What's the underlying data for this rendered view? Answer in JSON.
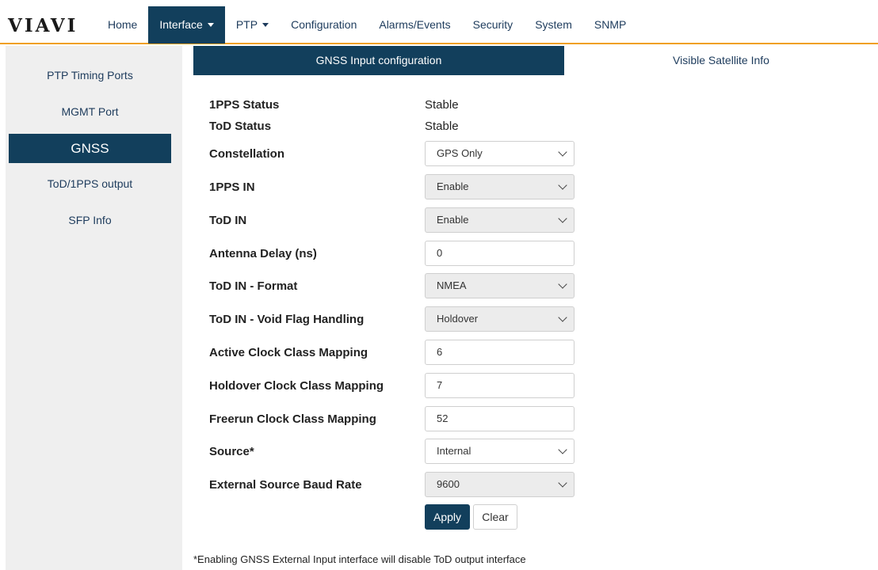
{
  "brand": {
    "logo_text": "VIAVI"
  },
  "nav": {
    "items": [
      {
        "label": "Home",
        "dropdown": false,
        "active": false
      },
      {
        "label": "Interface",
        "dropdown": true,
        "active": true
      },
      {
        "label": "PTP",
        "dropdown": true,
        "active": false
      },
      {
        "label": "Configuration",
        "dropdown": false,
        "active": false
      },
      {
        "label": "Alarms/Events",
        "dropdown": false,
        "active": false
      },
      {
        "label": "Security",
        "dropdown": false,
        "active": false
      },
      {
        "label": "System",
        "dropdown": false,
        "active": false
      },
      {
        "label": "SNMP",
        "dropdown": false,
        "active": false
      }
    ]
  },
  "sidebar": {
    "items": [
      {
        "label": "PTP Timing Ports",
        "active": false
      },
      {
        "label": "MGMT Port",
        "active": false
      },
      {
        "label": "GNSS",
        "active": true
      },
      {
        "label": "ToD/1PPS output",
        "active": false
      },
      {
        "label": "SFP Info",
        "active": false
      }
    ]
  },
  "tabs": [
    {
      "label": "GNSS Input configuration",
      "active": true
    },
    {
      "label": "Visible Satellite Info",
      "active": false
    }
  ],
  "status": {
    "pps_label": "1PPS Status",
    "pps_value": "Stable",
    "tod_label": "ToD Status",
    "tod_value": "Stable"
  },
  "form": {
    "constellation": {
      "label": "Constellation",
      "value": "GPS Only"
    },
    "pps_in": {
      "label": "1PPS IN",
      "value": "Enable"
    },
    "tod_in": {
      "label": "ToD IN",
      "value": "Enable"
    },
    "antenna_delay": {
      "label": "Antenna Delay (ns)",
      "value": "0"
    },
    "tod_format": {
      "label": "ToD IN - Format",
      "value": "NMEA"
    },
    "void_flag": {
      "label": "ToD IN - Void Flag Handling",
      "value": "Holdover"
    },
    "active_class": {
      "label": "Active Clock Class Mapping",
      "value": "6"
    },
    "holdover_class": {
      "label": "Holdover Clock Class Mapping",
      "value": "7"
    },
    "freerun_class": {
      "label": "Freerun Clock Class Mapping",
      "value": "52"
    },
    "source": {
      "label": "Source*",
      "value": "Internal"
    },
    "baud_rate": {
      "label": "External Source Baud Rate",
      "value": "9600"
    }
  },
  "buttons": {
    "apply": "Apply",
    "clear": "Clear"
  },
  "footnote": "*Enabling GNSS External Input interface will disable ToD output interface",
  "colors": {
    "primary": "#123f5c",
    "accent_line": "#f0a020",
    "sidebar_bg": "#efefef"
  }
}
